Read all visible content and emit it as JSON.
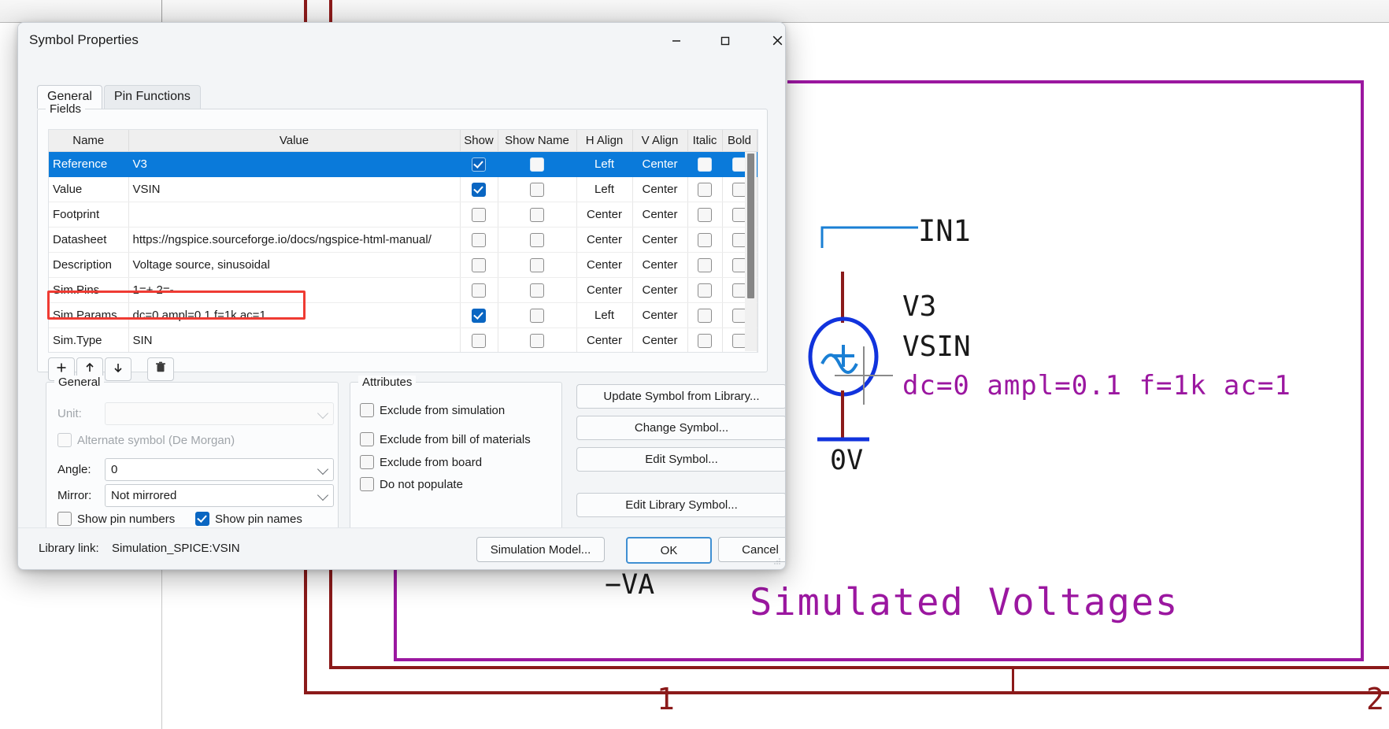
{
  "window": {
    "title": "Symbol Properties",
    "minimize_icon": "minimize-icon",
    "maximize_icon": "maximize-icon",
    "close_icon": "close-icon"
  },
  "tabs": [
    {
      "label": "General",
      "selected": true
    },
    {
      "label": "Pin Functions",
      "selected": false
    }
  ],
  "fields_group": {
    "title": "Fields",
    "columns": [
      "Name",
      "Value",
      "Show",
      "Show Name",
      "H Align",
      "V Align",
      "Italic",
      "Bold"
    ],
    "rows": [
      {
        "name": "Reference",
        "value": "V3",
        "show": true,
        "show_name": false,
        "h_align": "Left",
        "v_align": "Center",
        "italic": false,
        "bold": false,
        "selected": true,
        "highlight": false
      },
      {
        "name": "Value",
        "value": "VSIN",
        "show": true,
        "show_name": false,
        "h_align": "Left",
        "v_align": "Center",
        "italic": false,
        "bold": false,
        "selected": false,
        "highlight": false
      },
      {
        "name": "Footprint",
        "value": "",
        "show": false,
        "show_name": false,
        "h_align": "Center",
        "v_align": "Center",
        "italic": false,
        "bold": false,
        "selected": false,
        "highlight": false
      },
      {
        "name": "Datasheet",
        "value": "https://ngspice.sourceforge.io/docs/ngspice-html-manual/",
        "show": false,
        "show_name": false,
        "h_align": "Center",
        "v_align": "Center",
        "italic": false,
        "bold": false,
        "selected": false,
        "highlight": false
      },
      {
        "name": "Description",
        "value": "Voltage source, sinusoidal",
        "show": false,
        "show_name": false,
        "h_align": "Center",
        "v_align": "Center",
        "italic": false,
        "bold": false,
        "selected": false,
        "highlight": false
      },
      {
        "name": "Sim.Pins",
        "value": "1=+ 2=-",
        "show": false,
        "show_name": false,
        "h_align": "Center",
        "v_align": "Center",
        "italic": false,
        "bold": false,
        "selected": false,
        "highlight": false
      },
      {
        "name": "Sim.Params",
        "value": "dc=0 ampl=0.1 f=1k ac=1",
        "show": true,
        "show_name": false,
        "h_align": "Left",
        "v_align": "Center",
        "italic": false,
        "bold": false,
        "selected": false,
        "highlight": true
      },
      {
        "name": "Sim.Type",
        "value": "SIN",
        "show": false,
        "show_name": false,
        "h_align": "Center",
        "v_align": "Center",
        "italic": false,
        "bold": false,
        "selected": false,
        "highlight": false
      }
    ],
    "toolbar": {
      "add_label": "+",
      "move_up_label": "↑",
      "move_down_label": "↓",
      "delete_label": "\u0001"
    },
    "highlight_color": "#ef3b33",
    "selection_color": "#0a7ada"
  },
  "general_group": {
    "title": "General",
    "unit_label": "Unit:",
    "unit_value": "",
    "alternate_symbol_label": "Alternate symbol (De Morgan)",
    "alternate_symbol_checked": false,
    "angle_label": "Angle:",
    "angle_value": "0",
    "mirror_label": "Mirror:",
    "mirror_value": "Not mirrored",
    "show_pin_numbers_label": "Show pin numbers",
    "show_pin_numbers_checked": false,
    "show_pin_names_label": "Show pin names",
    "show_pin_names_checked": true
  },
  "attributes_group": {
    "title": "Attributes",
    "items": [
      {
        "label": "Exclude from simulation",
        "checked": false
      },
      {
        "label": "Exclude from bill of materials",
        "checked": false
      },
      {
        "label": "Exclude from board",
        "checked": false
      },
      {
        "label": "Do not populate",
        "checked": false
      }
    ]
  },
  "actions": [
    "Update Symbol from Library...",
    "Change Symbol...",
    "Edit Symbol...",
    "Edit Library Symbol..."
  ],
  "footer": {
    "library_link_label": "Library link:",
    "library_link_value": "Simulation_SPICE:VSIN",
    "simulation_model_label": "Simulation Model...",
    "ok_label": "OK",
    "cancel_label": "Cancel"
  },
  "schematic": {
    "net_label": "IN1",
    "reference": "V3",
    "value": "VSIN",
    "sim_params": "dc=0 ampl=0.1 f=1k ac=1",
    "ground_label": "0V",
    "neg_va_label": "−VA",
    "sheet_note": "Simulated Voltages",
    "frame_cell_1": "1",
    "frame_cell_2": "2",
    "colors": {
      "wire": "#1a7fd4",
      "symbol": "#1133dd",
      "pin": "#8b1a1a",
      "text_black": "#1a1a1a",
      "text_purple": "#9b17a0",
      "frame": "#8b1a1a",
      "sheet_border": "#9b17a0"
    }
  }
}
